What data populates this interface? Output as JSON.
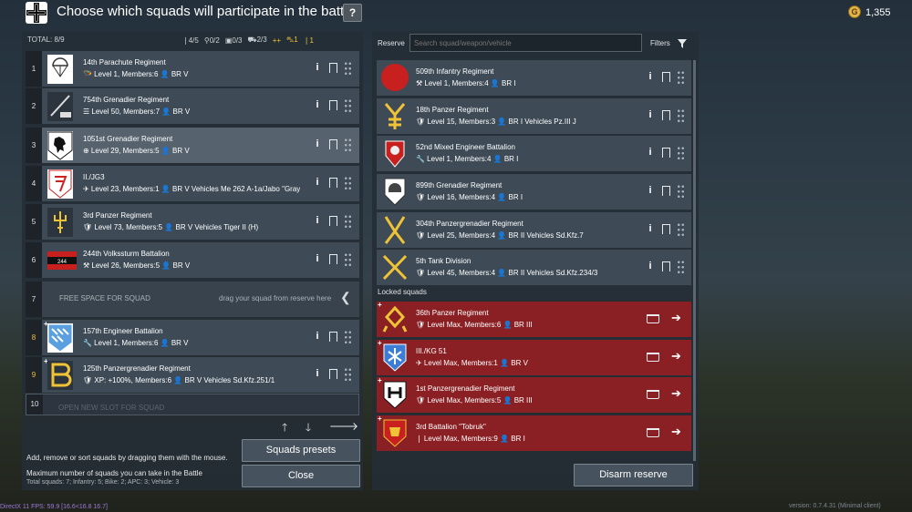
{
  "header": {
    "title": "Choose which squads will participate in the battle",
    "help": "?",
    "gold": "G",
    "currency": "1,355"
  },
  "left": {
    "total": "TOTAL: 8/9",
    "counts": [
      {
        "icon": "infantry-icon",
        "text": "4/5",
        "yellow": false
      },
      {
        "icon": "bike-icon",
        "text": "0/2",
        "yellow": false
      },
      {
        "icon": "apc-icon",
        "text": "0/3",
        "yellow": false
      },
      {
        "icon": "tank-icon",
        "text": "2/3",
        "yellow": false
      },
      {
        "icon": "plus-icon",
        "text": "+",
        "yellow": true
      },
      {
        "icon": "car-icon",
        "text": "1",
        "yellow": true
      },
      {
        "icon": "infantry-icon",
        "text": "1",
        "yellow": true
      }
    ],
    "rows": [
      {
        "num": "1",
        "name": "14th Parachute Regiment",
        "info": "🪂 Level 1, Members:6 👤 BR V",
        "emblem": "parachute-emblem",
        "selected": false,
        "numYellow": false
      },
      {
        "num": "2",
        "name": "754th Grenadier Regiment",
        "info": "☰ Level 50, Members:7 👤 BR V",
        "emblem": "rifle-emblem",
        "selected": false,
        "numYellow": false
      },
      {
        "num": "3",
        "name": "1051st Grenadier Regiment",
        "info": "⊕ Level 29, Members:5 👤 BR V",
        "emblem": "bear-emblem",
        "selected": true,
        "numYellow": false
      },
      {
        "num": "4",
        "name": "II./JG3",
        "info": "✈ Level 23, Members:1 👤 BR V  Vehicles Me 262 A-1a/Jabo \"Gray",
        "emblem": "jg3-emblem",
        "selected": false,
        "numYellow": false
      },
      {
        "num": "5",
        "name": "3rd Panzer Regiment",
        "info": "🛡 Level 73, Members:5 👤 BR V  Vehicles Tiger II (H)",
        "emblem": "trident-emblem",
        "selected": false,
        "numYellow": false
      },
      {
        "num": "6",
        "name": "244th Volkssturm Battalion",
        "info": "⚒ Level 26, Members:5 👤 BR V",
        "emblem": "volkssturm-emblem",
        "selected": false,
        "numYellow": false
      },
      {
        "num": "8",
        "name": "157th Engineer Battalion",
        "info": "🔧 Level 1, Members:6 👤 BR V",
        "emblem": "bavaria-emblem",
        "selected": false,
        "numYellow": true
      },
      {
        "num": "9",
        "name": "125th Panzergrenadier Regiment",
        "info": "🛡 XP: +100%, Members:6 👤 BR V  Vehicles Sd.Kfz.251/1",
        "emblem": "b-emblem",
        "selected": false,
        "numYellow": true
      }
    ],
    "free": {
      "num": "7",
      "left": "FREE SPACE FOR SQUAD",
      "right": "drag your squad from reserve here"
    },
    "ghost": {
      "num": "10",
      "text": "OPEN NEW SLOT FOR SQUAD"
    },
    "hint": "Add, remove or sort squads by dragging them with the mouse.",
    "max": "Maximum number of squads you can take in the Battle",
    "totals": "Total squads: 7; Infantry: 5; Bike: 2; APC: 3; Vehicle: 3",
    "presets": "Squads presets",
    "close": "Close"
  },
  "right": {
    "reserve": "Reserve",
    "search_placeholder": "Search squad/weapon/vehicle",
    "filters": "Filters",
    "rows": [
      {
        "name": "509th Infantry Regiment",
        "info": "⚒ Level 1, Members:4 👤 BR I",
        "emblem": "red-circle-emblem"
      },
      {
        "name": "18th Panzer Regiment",
        "info": "🛡 Level 15, Members:3 👤 BR I  Vehicles Pz.III J",
        "emblem": "yellow-y-emblem"
      },
      {
        "name": "52nd Mixed Engineer Battalion",
        "info": "🔧 Level 1, Members:4 👤 BR I",
        "emblem": "engineer-shield-emblem"
      },
      {
        "name": "899th Grenadier Regiment",
        "info": "🛡 Level 16, Members:4 👤 BR I",
        "emblem": "helmet-emblem"
      },
      {
        "name": "304th Panzergrenadier Regiment",
        "info": "🛡 Level 25, Members:4 👤 BR II  Vehicles Sd.Kfz.7",
        "emblem": "yellow-fork-emblem"
      },
      {
        "name": "5th Tank Division",
        "info": "🛡 Level 45, Members:4 👤 BR II  Vehicles Sd.Kfz.234/3",
        "emblem": "yellow-x-emblem"
      }
    ],
    "locked_label": "Locked squads",
    "locked": [
      {
        "name": "36th Panzer Regiment",
        "info": "🛡 Level Max, Members:6 👤 BR III",
        "emblem": "yellow-rune-emblem"
      },
      {
        "name": "III./KG 51",
        "info": "✈ Level Max, Members:1 👤 BR V",
        "emblem": "edelweiss-emblem"
      },
      {
        "name": "1st Panzergrenadier Regiment",
        "info": "🛡 Level Max, Members:5 👤 BR III",
        "emblem": "h-emblem"
      },
      {
        "name": "3rd Battalion \"Tobruk\"",
        "info": "❘ Level Max, Members:9 👤 BR I",
        "emblem": "lion-emblem"
      }
    ],
    "disarm": "Disarm reserve"
  },
  "footer": {
    "left": "DirectX 11  FPS: 59.9  [16.6<16.8 16.7]",
    "right": "version: 0.7.4.31 (Minimal client)"
  },
  "colors": {
    "panel": "#252d35",
    "row": "#3e4b57",
    "locked": "#8a2024",
    "accent": "#f0c236"
  }
}
